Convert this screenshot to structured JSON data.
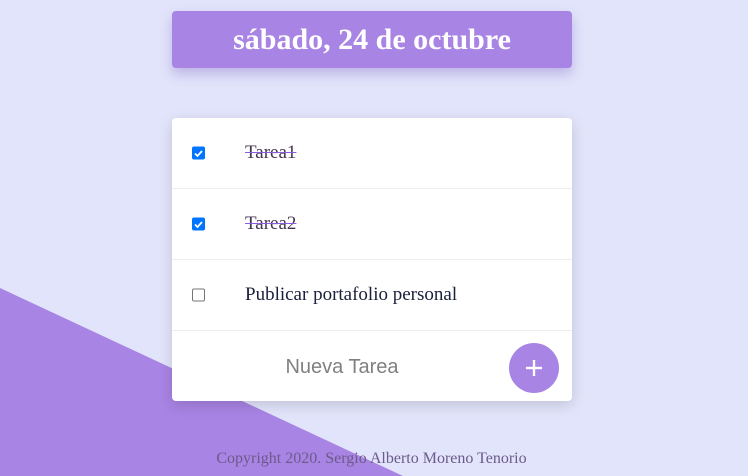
{
  "header": {
    "date": "sábado, 24 de octubre"
  },
  "tasks": [
    {
      "label": "Tarea1",
      "completed": true
    },
    {
      "label": "Tarea2",
      "completed": true
    },
    {
      "label": "Publicar portafolio personal",
      "completed": false
    }
  ],
  "new_task": {
    "placeholder": "Nueva Tarea",
    "add_button_icon": "plus-icon"
  },
  "footer": {
    "copyright": "Copyright 2020. Sergio Alberto Moreno Tenorio"
  },
  "colors": {
    "accent": "#a884e4",
    "background": "#e2e4fb",
    "checkbox": "#0075ff"
  }
}
